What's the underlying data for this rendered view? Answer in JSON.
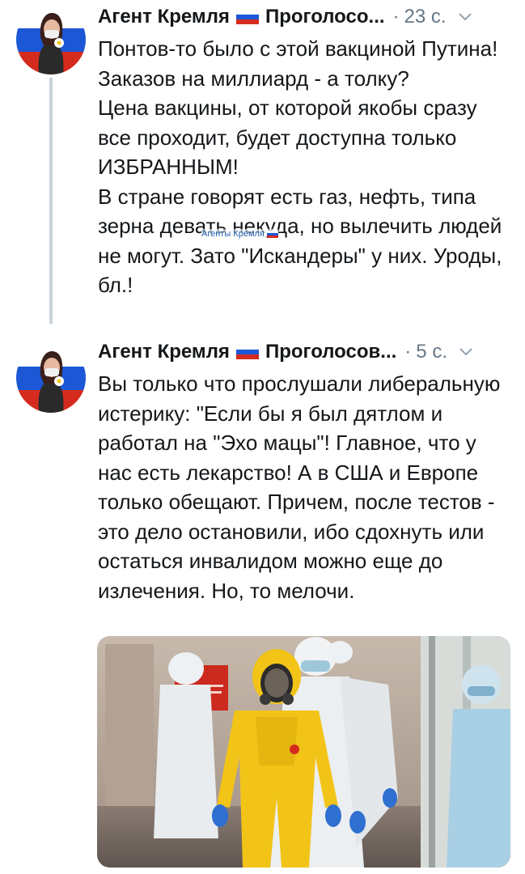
{
  "tweets": [
    {
      "author": "Агент Кремля",
      "handle": "Проголосо...",
      "time": "23 с.",
      "paragraphs": [
        "Понтов-то было с этой вакциной Путина! Заказов на миллиард - а толку?",
        "Цена вакцины, от которой якобы сразу все проходит, будет доступна только ИЗБРАННЫМ!",
        "В стране говорят есть газ, нефть, типа зерна девать некуда, но вылечить людей не могут. Зато \"Искандеры\" у них. Уроды, бл.!"
      ]
    },
    {
      "author": "Агент Кремля",
      "handle": "Проголосов...",
      "time": "5 с.",
      "paragraphs": [
        "Вы только что прослушали либеральную истерику: \"Если бы я был дятлом и работал на \"Эхо мацы\"! Главное, что у нас есть лекарство! А в США и Европе только обещают. Причем, после тестов - это дело остановили, ибо сдохнуть или остаться инвалидом можно еще до излечения. Но, то мелочи."
      ]
    }
  ],
  "watermark": "Агенты Кремля",
  "colors": {
    "text": "#14171a",
    "meta": "#657786",
    "thread_line": "#c9d3da",
    "flag_white": "#ffffff",
    "flag_blue": "#1c57d6",
    "flag_red": "#d52b1e",
    "hazmat_yellow": "#f2c418"
  }
}
